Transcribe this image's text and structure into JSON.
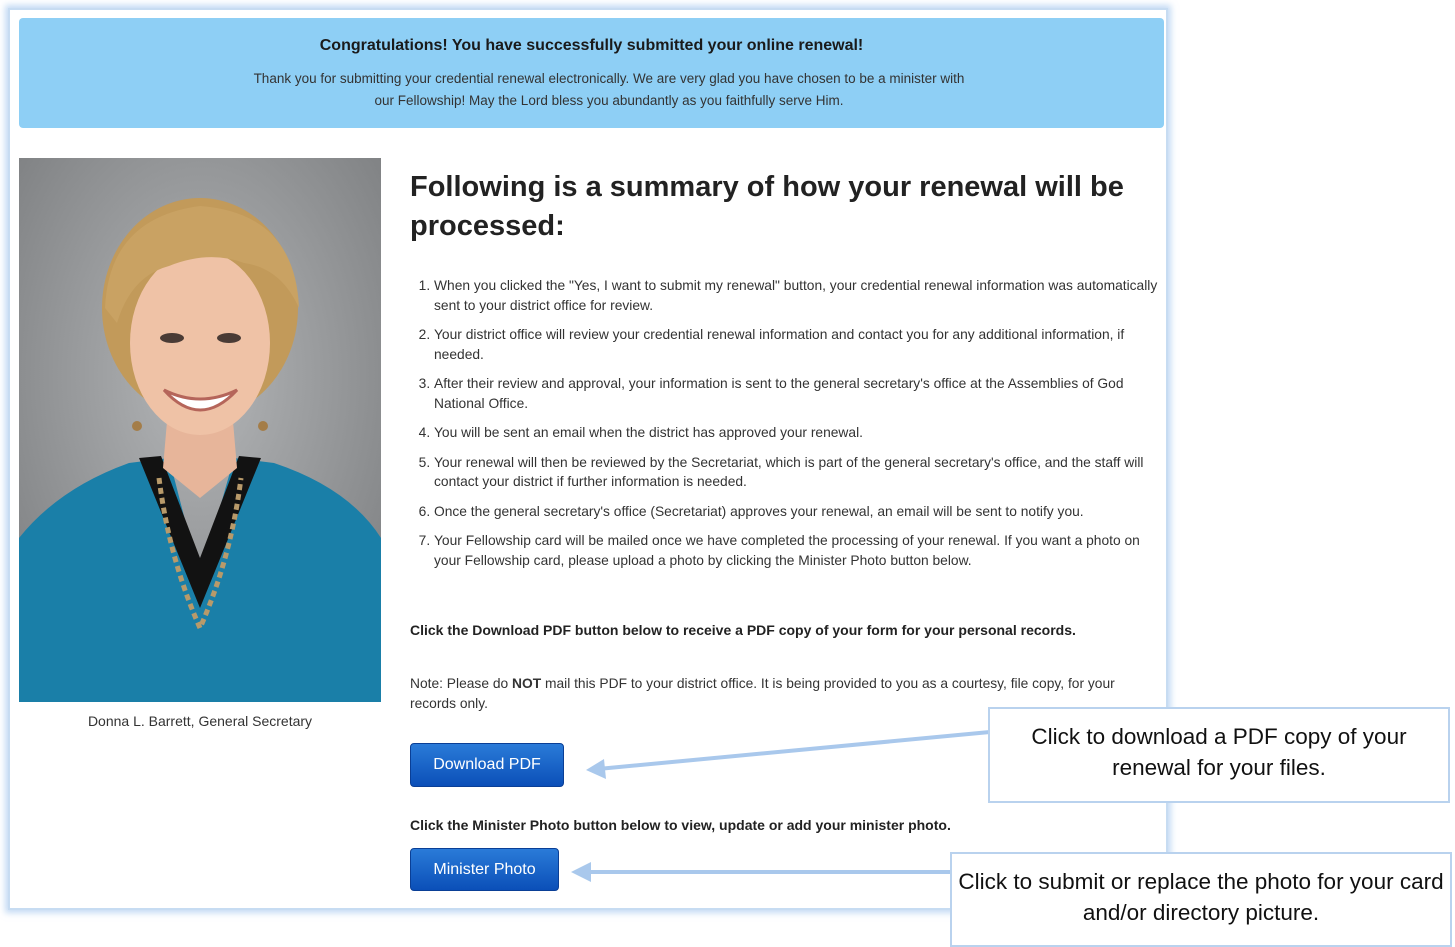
{
  "banner": {
    "title": "Congratulations! You have successfully submitted your online renewal!",
    "message": "Thank you for submitting your credential renewal electronically. We are very glad you have chosen to be a minister with our Fellowship! May the Lord bless you abundantly as you faithfully serve Him."
  },
  "portrait": {
    "caption": "Donna L. Barrett, General Secretary"
  },
  "summary": {
    "heading": "Following is a summary of how your renewal will be processed:",
    "steps": [
      "When you clicked the \"Yes, I want to submit my renewal\" button, your credential renewal information was automatically sent to your district office for review.",
      "Your district office will review your credential renewal information and contact you for any additional information, if needed.",
      "After their review and approval, your information is sent to the general secretary's office at the Assemblies of God National Office.",
      "You will be sent an email when the district has approved your renewal.",
      "Your renewal will then be reviewed by the Secretariat, which is part of the general secretary's office, and the staff will contact your district if further information is needed.",
      "Once the general secretary's office (Secretariat) approves your renewal, an email will be sent to notify you.",
      "Your Fellowship card will be mailed once we have completed the processing of your renewal. If you want a photo on your Fellowship card, please upload a photo by clicking the Minister Photo button below."
    ]
  },
  "download": {
    "instruction": "Click the Download PDF button below to receive a PDF copy of your form for your personal records.",
    "note_prefix": "Note: Please do ",
    "note_emphasis": "NOT",
    "note_suffix": " mail this PDF to your district office. It is being provided to you as a courtesy, file copy, for your records only.",
    "button_label": "Download PDF"
  },
  "minister_photo": {
    "instruction": "Click the Minister Photo button below to view, update or add your minister photo.",
    "button_label": "Minister Photo"
  },
  "callouts": {
    "download": "Click to download a PDF copy of your renewal for your files.",
    "photo": "Click to submit or replace the photo for your card and/or directory picture."
  },
  "colors": {
    "banner_bg": "#8ecff5",
    "button_blue": "#0b4fb8",
    "callout_border": "#b9d2ee",
    "arrow": "#a9c8ec"
  }
}
